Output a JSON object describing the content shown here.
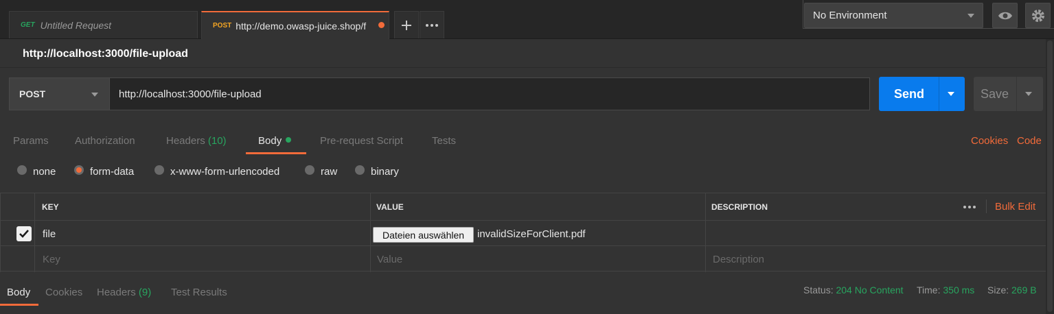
{
  "tabs": [
    {
      "method": "GET",
      "name": "Untitled Request"
    },
    {
      "method": "POST",
      "name": "http://demo.owasp-juice.shop/f"
    }
  ],
  "tab_actions": {
    "plus_icon": "plus-icon",
    "more_icon": "ellipsis-icon"
  },
  "environment": {
    "selected": "No Environment",
    "eye_icon": "eye-icon",
    "settings_icon": "gear-icon"
  },
  "request": {
    "title": "http://localhost:3000/file-upload",
    "method": "POST",
    "url": "http://localhost:3000/file-upload",
    "send_label": "Send",
    "save_label": "Save"
  },
  "request_tabs": [
    {
      "label": "Params"
    },
    {
      "label": "Authorization"
    },
    {
      "label": "Headers",
      "count": "(10)"
    },
    {
      "label": "Body"
    },
    {
      "label": "Pre-request Script"
    },
    {
      "label": "Tests"
    }
  ],
  "links": {
    "cookies": "Cookies",
    "code": "Code"
  },
  "body_types": [
    {
      "label": "none",
      "selected": false
    },
    {
      "label": "form-data",
      "selected": true
    },
    {
      "label": "x-www-form-urlencoded",
      "selected": false
    },
    {
      "label": "raw",
      "selected": false
    },
    {
      "label": "binary",
      "selected": false
    }
  ],
  "table": {
    "headers": {
      "key": "KEY",
      "value": "VALUE",
      "description": "DESCRIPTION"
    },
    "bulk_edit": "Bulk Edit",
    "rows": [
      {
        "checked": true,
        "key": "file",
        "file_button": "Dateien auswählen",
        "file_name": "invalidSizeForClient.pdf"
      }
    ],
    "placeholders": {
      "key": "Key",
      "value": "Value",
      "description": "Description"
    }
  },
  "response_tabs": [
    {
      "label": "Body"
    },
    {
      "label": "Cookies"
    },
    {
      "label": "Headers",
      "count": "(9)"
    },
    {
      "label": "Test Results"
    }
  ],
  "status": {
    "status_label": "Status:",
    "status_value": "204 No Content",
    "time_label": "Time:",
    "time_value": "350 ms",
    "size_label": "Size:",
    "size_value": "269 B"
  },
  "colors": {
    "accent": "#f26b3a",
    "send": "#097bed",
    "success": "#28a55f"
  }
}
